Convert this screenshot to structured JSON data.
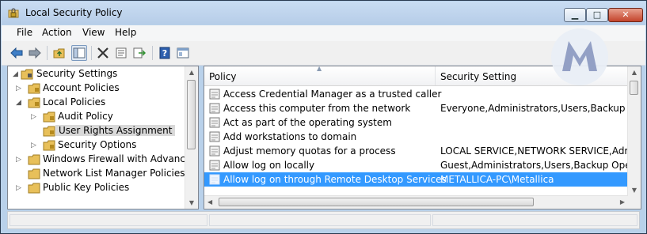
{
  "window": {
    "title": "Local Security Policy",
    "controls": {
      "minimize": "▁",
      "maximize": "□",
      "close": "✕"
    }
  },
  "menu": [
    "File",
    "Action",
    "View",
    "Help"
  ],
  "toolbar": {
    "icons": [
      "back-arrow-icon",
      "forward-arrow-icon",
      "up-folder-icon",
      "show-hide-tree-icon",
      "delete-icon",
      "properties-icon",
      "export-list-icon",
      "help-icon",
      "extended-view-icon"
    ]
  },
  "tree": [
    {
      "label": "Security Settings",
      "expander": "◢",
      "level": 0
    },
    {
      "label": "Account Policies",
      "expander": "▷",
      "level": 1
    },
    {
      "label": "Local Policies",
      "expander": "◢",
      "level": 1
    },
    {
      "label": "Audit Policy",
      "expander": "▷",
      "level": 2
    },
    {
      "label": "User Rights Assignment",
      "expander": "",
      "level": 2,
      "selected": true
    },
    {
      "label": "Security Options",
      "expander": "▷",
      "level": 2
    },
    {
      "label": "Windows Firewall with Advanced S",
      "expander": "▷",
      "level": 1
    },
    {
      "label": "Network List Manager Policies",
      "expander": "",
      "level": 1
    },
    {
      "label": "Public Key Policies",
      "expander": "▷",
      "level": 1
    }
  ],
  "list": {
    "columns": [
      "Policy",
      "Security Setting"
    ],
    "rows": [
      {
        "policy": "Access Credential Manager as a trusted caller",
        "setting": ""
      },
      {
        "policy": "Access this computer from the network",
        "setting": "Everyone,Administrators,Users,Backup Opera"
      },
      {
        "policy": "Act as part of the operating system",
        "setting": ""
      },
      {
        "policy": "Add workstations to domain",
        "setting": ""
      },
      {
        "policy": "Adjust memory quotas for a process",
        "setting": "LOCAL SERVICE,NETWORK SERVICE,Adminis"
      },
      {
        "policy": "Allow log on locally",
        "setting": "Guest,Administrators,Users,Backup Operator"
      },
      {
        "policy": "Allow log on through Remote Desktop Services",
        "setting": "METALLICA-PC\\Metallica",
        "selected": true
      }
    ]
  },
  "colors": {
    "selection": "#3399ff",
    "titlebar": "#b9d1ea",
    "folder": "#e8c05a"
  }
}
